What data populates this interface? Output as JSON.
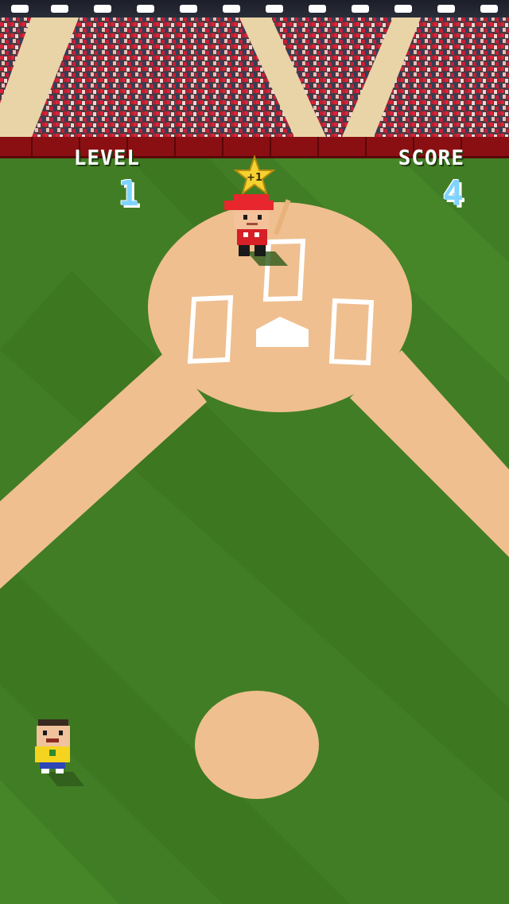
{
  "hud": {
    "level_label": "LEVEL",
    "level_value": "1",
    "score_label": "SCORE",
    "score_value": "4"
  },
  "popup": {
    "star_bonus": "+1"
  },
  "colors": {
    "grass_dark": "#3b7420",
    "grass_light": "#4a8a2c",
    "dirt": "#efbf8f",
    "wall": "#8a0f12",
    "score_digit": "#7fd3ff"
  },
  "sprites": {
    "batter": "batter-sprite",
    "pitcher": "pitcher-sprite",
    "star": "star-icon"
  }
}
